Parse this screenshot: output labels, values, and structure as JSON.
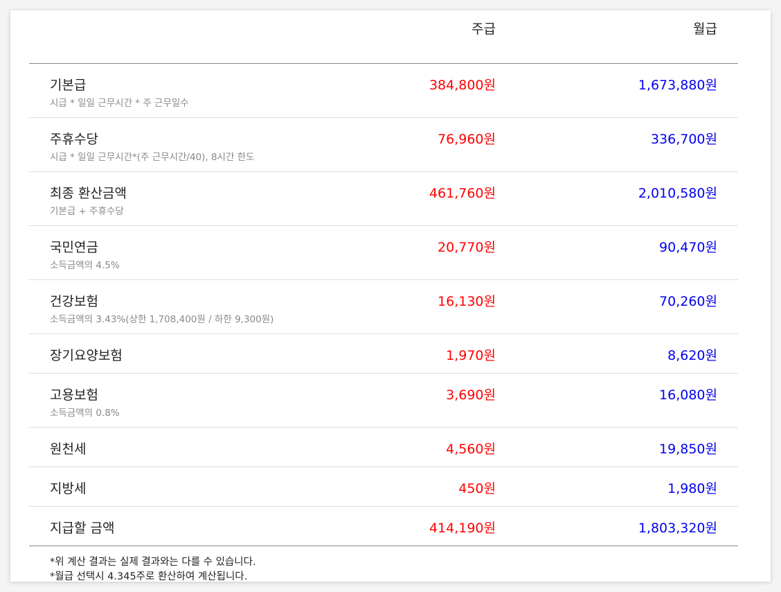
{
  "header": {
    "weekly": "주급",
    "monthly": "월급"
  },
  "rows": [
    {
      "label": "기본급",
      "sub": "시급 * 일일 근무시간 * 주 근무일수",
      "weekly": "384,800원",
      "monthly": "1,673,880원"
    },
    {
      "label": "주휴수당",
      "sub": "시급 * 일일 근무시간*(주 근무시간/40), 8시간 한도",
      "weekly": "76,960원",
      "monthly": "336,700원"
    },
    {
      "label": "최종 환산금액",
      "sub": "기본급 + 주휴수당",
      "weekly": "461,760원",
      "monthly": "2,010,580원"
    },
    {
      "label": "국민연금",
      "sub": "소득금액의 4.5%",
      "weekly": "20,770원",
      "monthly": "90,470원"
    },
    {
      "label": "건강보험",
      "sub": "소득금액의 3.43%(상한 1,708,400원 / 하한 9,300원)",
      "weekly": "16,130원",
      "monthly": "70,260원"
    },
    {
      "label": "장기요양보험",
      "sub": "",
      "weekly": "1,970원",
      "monthly": "8,620원"
    },
    {
      "label": "고용보험",
      "sub": "소득금액의 0.8%",
      "weekly": "3,690원",
      "monthly": "16,080원"
    },
    {
      "label": "원천세",
      "sub": "",
      "weekly": "4,560원",
      "monthly": "19,850원"
    },
    {
      "label": "지방세",
      "sub": "",
      "weekly": "450원",
      "monthly": "1,980원"
    },
    {
      "label": "지급할 금액",
      "sub": "",
      "weekly": "414,190원",
      "monthly": "1,803,320원"
    }
  ],
  "notes": [
    "*위 계산 결과는 실제 결과와는 다를 수 있습니다.",
    "*월급 선택시 4.345주로 환산하여 계산됩니다."
  ],
  "colors": {
    "weekly": "#ff0000",
    "monthly": "#0000ee"
  }
}
